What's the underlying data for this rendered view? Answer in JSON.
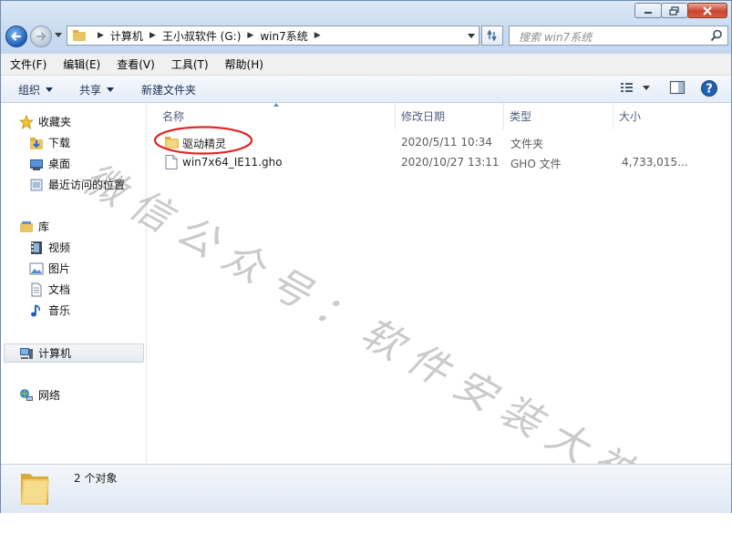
{
  "window": {
    "controls": {
      "minimize": "minimize",
      "maximize": "maximize",
      "close": "close"
    }
  },
  "address": {
    "crumbs": [
      "计算机",
      "王小叔软件 (G:)",
      "win7系统"
    ]
  },
  "search": {
    "placeholder": "搜索 win7系统"
  },
  "menu": [
    "文件(F)",
    "编辑(E)",
    "查看(V)",
    "工具(T)",
    "帮助(H)"
  ],
  "toolbar": {
    "organize": "组织",
    "share": "共享",
    "new_folder": "新建文件夹"
  },
  "nav": {
    "favorites": "收藏夹",
    "favorites_items": [
      "下载",
      "桌面",
      "最近访问的位置"
    ],
    "libraries": "库",
    "library_items": [
      "视频",
      "图片",
      "文档",
      "音乐"
    ],
    "computer": "计算机",
    "network": "网络"
  },
  "columns": [
    "名称",
    "修改日期",
    "类型",
    "大小"
  ],
  "files": [
    {
      "name": "驱动精灵",
      "modified": "2020/5/11 10:34",
      "type": "文件夹",
      "size": "",
      "icon": "folder-icon"
    },
    {
      "name": "win7x64_IE11.gho",
      "modified": "2020/10/27 13:11",
      "type": "GHO 文件",
      "size": "4,733,015...",
      "icon": "file-icon"
    }
  ],
  "watermark": "微信公众号：软件安装大神",
  "status": {
    "count": "2 个对象"
  },
  "colors": {
    "accent": "#1f5fb8",
    "annotation": "#e0282a",
    "header_text": "#4c607a"
  }
}
